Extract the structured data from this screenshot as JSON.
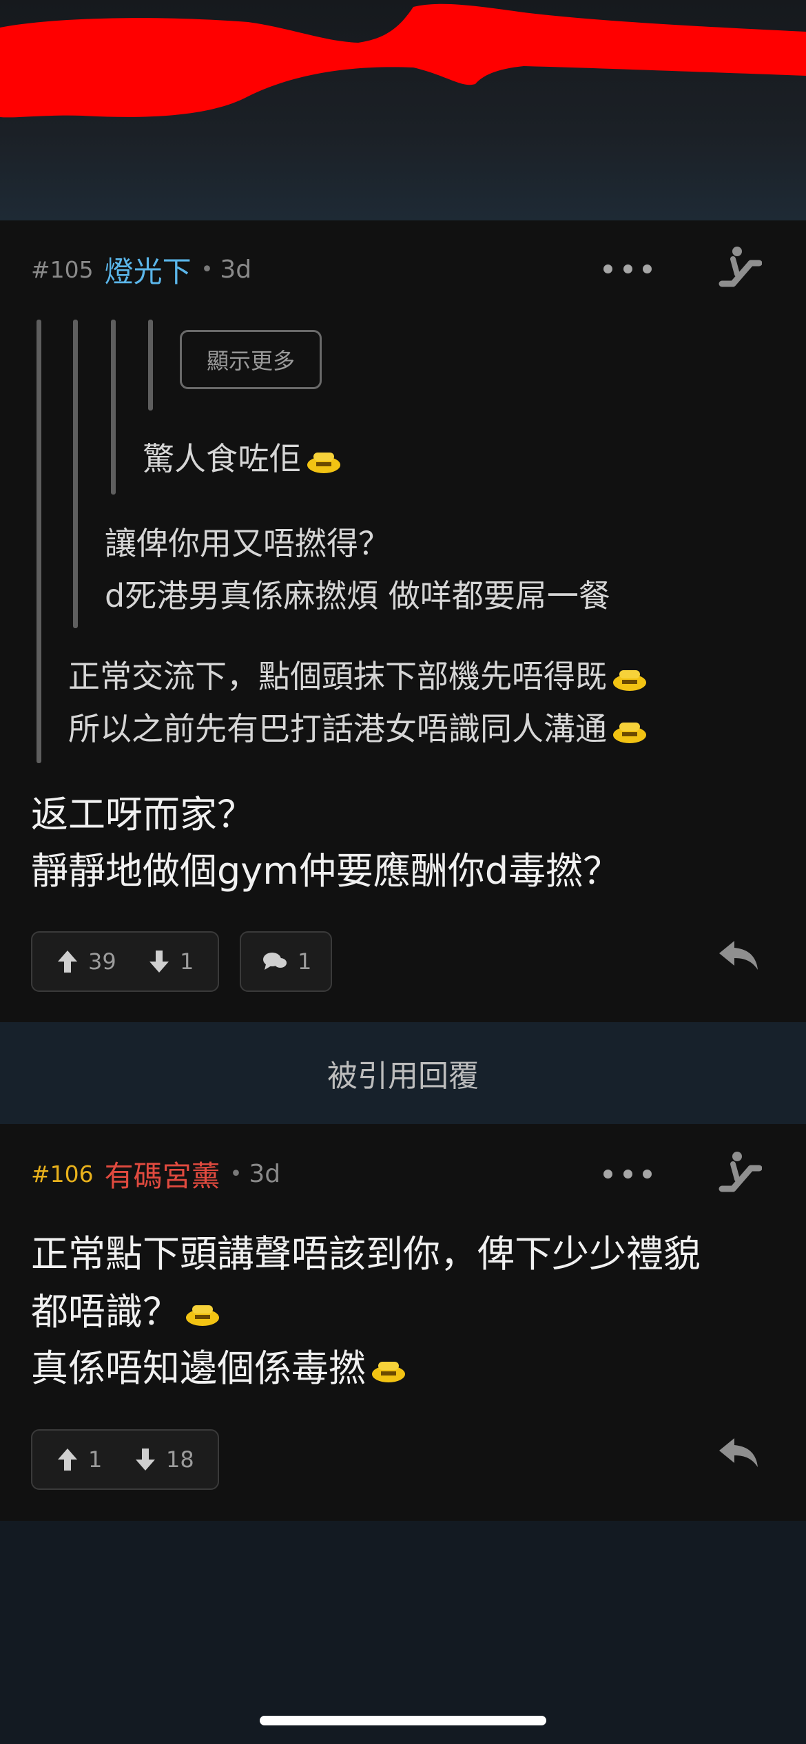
{
  "colors": {
    "username_blue": "#5bb6ea",
    "username_red": "#e04a3f",
    "post_number_gold": "#e8b11c",
    "redaction": "#ff0000"
  },
  "posts": [
    {
      "number": "#105",
      "username": "燈光下",
      "time": "3d",
      "more_icon": "ellipsis-icon",
      "action_icon": "escalator-icon",
      "show_more_label": "顯示更多",
      "quotes": {
        "level4": [
          "驚人食咗佢"
        ],
        "level3": [
          "讓俾你用又唔撚得？",
          "d死港男真係麻撚煩 做咩都要屌一餐"
        ],
        "level2": [
          "正常交流下，點個頭抹下部機先唔得既",
          "所以之前先有巴打話港女唔識同人溝通"
        ]
      },
      "body": [
        "返工呀而家？",
        "靜靜地做個gym仲要應酬你d毒撚？"
      ],
      "upvotes": "39",
      "downvotes": "1",
      "comments": "1",
      "reply_icon": "reply-icon"
    },
    {
      "number": "#106",
      "username": "有碼宮薰",
      "time": "3d",
      "more_icon": "ellipsis-icon",
      "action_icon": "escalator-icon",
      "body": [
        "正常點下頭講聲唔該到你，俾下少少禮貌",
        "都唔識？",
        "真係唔知邊個係毒撚"
      ],
      "upvotes": "1",
      "downvotes": "18",
      "reply_icon": "reply-icon"
    }
  ],
  "quoted_replies_label": "被引用回覆"
}
